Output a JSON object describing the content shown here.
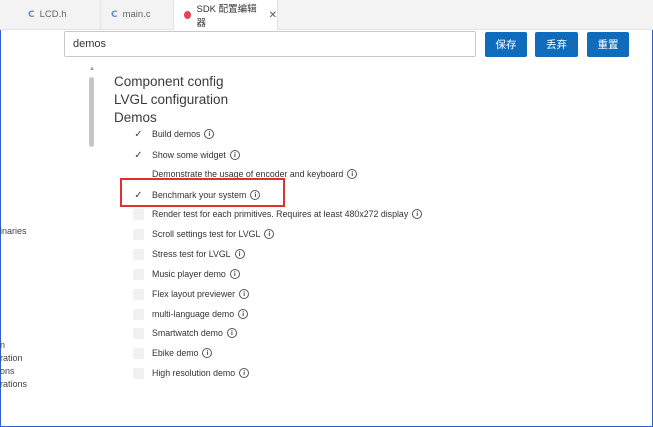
{
  "tabs": [
    {
      "label": "LCD.h",
      "icon": "c-file-icon"
    },
    {
      "label": "main.c",
      "icon": "c-file-icon"
    },
    {
      "label": "SDK 配置编辑器",
      "icon": "sdk-config-icon",
      "close": "✕"
    }
  ],
  "search": {
    "value": "demos"
  },
  "buttons": {
    "save": "保存",
    "discard": "丢弃",
    "reset": "重置"
  },
  "left_labels": [
    "inaries",
    "n",
    "ration",
    "ons",
    "rations"
  ],
  "headings": [
    "Component config",
    "LVGL configuration",
    "Demos"
  ],
  "options": [
    {
      "label": "Build demos",
      "state": "checked"
    },
    {
      "label": "Show some widget",
      "state": "checked"
    },
    {
      "label": "Demonstrate the usage of encoder and keyboard",
      "state": "none"
    },
    {
      "label": "Benchmark your system",
      "state": "checked",
      "highlighted": true
    },
    {
      "label": "Render test for each primitives. Requires at least 480x272 display",
      "state": "unchecked"
    },
    {
      "label": "Scroll settings test for LVGL",
      "state": "unchecked"
    },
    {
      "label": "Stress test for LVGL",
      "state": "unchecked"
    },
    {
      "label": "Music player demo",
      "state": "unchecked"
    },
    {
      "label": "Flex layout previewer",
      "state": "unchecked"
    },
    {
      "label": "multi-language demo",
      "state": "unchecked"
    },
    {
      "label": "Smartwatch demo",
      "state": "unchecked"
    },
    {
      "label": "Ebike demo",
      "state": "unchecked"
    },
    {
      "label": "High resolution demo",
      "state": "unchecked"
    }
  ],
  "colors": {
    "accent": "#0f6cbd",
    "highlight": "#e03131",
    "frame": "#2f5fd0"
  }
}
